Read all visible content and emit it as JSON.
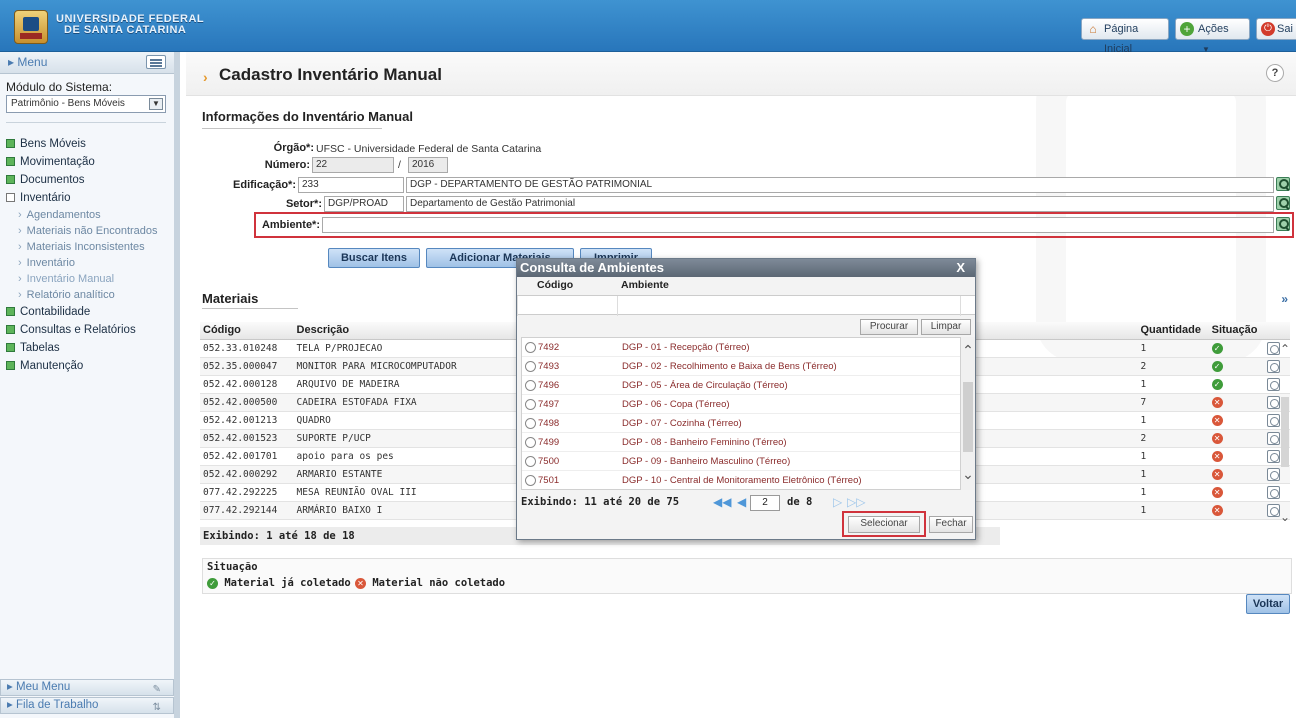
{
  "header": {
    "university_line1": "UNIVERSIDADE FEDERAL",
    "university_line2": "DE SANTA CATARINA",
    "home_label": "Página Inicial",
    "actions_label": "Ações",
    "exit_label": "Sai"
  },
  "sidebar": {
    "menu_label": "Menu",
    "module_label": "Módulo do Sistema:",
    "module_value": "Patrimônio - Bens Móveis",
    "items": [
      {
        "label": "Bens Móveis"
      },
      {
        "label": "Movimentação"
      },
      {
        "label": "Documentos"
      },
      {
        "label": "Inventário"
      },
      {
        "label": "Agendamentos"
      },
      {
        "label": "Materiais não Encontrados"
      },
      {
        "label": "Materiais Inconsistentes"
      },
      {
        "label": "Inventário"
      },
      {
        "label": "Inventário Manual"
      },
      {
        "label": "Relatório analítico"
      },
      {
        "label": "Contabilidade"
      },
      {
        "label": "Consultas e Relatórios"
      },
      {
        "label": "Tabelas"
      },
      {
        "label": "Manutenção"
      }
    ],
    "footer_my_menu": "Meu Menu",
    "footer_work_queue": "Fila de Trabalho"
  },
  "page": {
    "title": "Cadastro Inventário Manual",
    "section_info": "Informações do Inventário Manual",
    "orgao_label": "Órgão*:",
    "orgao_value": "UFSC - Universidade Federal de Santa Catarina",
    "numero_label": "Número:",
    "numero_value": "22",
    "numero_sep": "/",
    "ano_value": "2016",
    "edificacao_label": "Edificação*:",
    "edificacao_code": "233",
    "edificacao_name": "DGP - DEPARTAMENTO DE GESTÃO PATRIMONIAL",
    "setor_label": "Setor*:",
    "setor_code": "DGP/PROAD",
    "setor_name": "Departamento de Gestão Patrimonial",
    "ambiente_label": "Ambiente*:",
    "ambiente_value": "",
    "btn_buscar": "Buscar Itens",
    "btn_adicionar": "Adicionar Materiais",
    "btn_imprimir": "Imprimir",
    "section_materiais": "Materiais",
    "btn_voltar": "Voltar"
  },
  "table": {
    "headers": {
      "codigo": "Código",
      "descricao": "Descrição",
      "quantidade": "Quantidade",
      "situacao": "Situação"
    },
    "rows": [
      {
        "codigo": "052.33.010248",
        "descricao": "TELA P/PROJECAO",
        "quantidade": "1",
        "status": "ok"
      },
      {
        "codigo": "052.35.000047",
        "descricao": "MONITOR PARA MICROCOMPUTADOR",
        "quantidade": "2",
        "status": "ok"
      },
      {
        "codigo": "052.42.000128",
        "descricao": "ARQUIVO DE MADEIRA",
        "quantidade": "1",
        "status": "ok"
      },
      {
        "codigo": "052.42.000500",
        "descricao": "CADEIRA ESTOFADA FIXA",
        "quantidade": "7",
        "status": "no"
      },
      {
        "codigo": "052.42.001213",
        "descricao": "QUADRO",
        "quantidade": "1",
        "status": "no"
      },
      {
        "codigo": "052.42.001523",
        "descricao": "SUPORTE P/UCP",
        "quantidade": "2",
        "status": "no"
      },
      {
        "codigo": "052.42.001701",
        "descricao": "apoio para os pes",
        "quantidade": "1",
        "status": "no"
      },
      {
        "codigo": "052.42.000292",
        "descricao": "ARMARIO ESTANTE",
        "quantidade": "1",
        "status": "no"
      },
      {
        "codigo": "077.42.292225",
        "descricao": "MESA REUNIÃO OVAL III",
        "quantidade": "1",
        "status": "no"
      },
      {
        "codigo": "077.42.292144",
        "descricao": "ARMÁRIO BAIXO I",
        "quantidade": "1",
        "status": "no"
      }
    ],
    "footer": "Exibindo: 1 até 18 de 18"
  },
  "legend": {
    "title": "Situação",
    "collected": "Material já coletado",
    "not_collected": "Material não coletado"
  },
  "modal": {
    "title": "Consulta de Ambientes",
    "close": "X",
    "col_codigo": "Código",
    "col_ambiente": "Ambiente",
    "btn_procurar": "Procurar",
    "btn_limpar": "Limpar",
    "rows": [
      {
        "codigo": "7492",
        "ambiente": "DGP - 01 - Recepção (Térreo)"
      },
      {
        "codigo": "7493",
        "ambiente": "DGP - 02 - Recolhimento e Baixa de Bens (Térreo)"
      },
      {
        "codigo": "7496",
        "ambiente": "DGP - 05 - Área de Circulação (Térreo)"
      },
      {
        "codigo": "7497",
        "ambiente": "DGP - 06 - Copa (Térreo)"
      },
      {
        "codigo": "7498",
        "ambiente": "DGP - 07 - Cozinha (Térreo)"
      },
      {
        "codigo": "7499",
        "ambiente": "DGP - 08 - Banheiro Feminino (Térreo)"
      },
      {
        "codigo": "7500",
        "ambiente": "DGP - 09 - Banheiro Masculino (Térreo)"
      },
      {
        "codigo": "7501",
        "ambiente": "DGP - 10 - Central de Monitoramento Eletrônico (Térreo)"
      }
    ],
    "footer": "Exibindo: 11 até 20 de 75",
    "page_current": "2",
    "page_of": "de 8",
    "btn_selecionar": "Selecionar",
    "btn_fechar": "Fechar"
  },
  "colors": {
    "header_blue": "#2f84c8",
    "highlight_red": "#d0333c",
    "ok_green": "#3f9c3a",
    "not_collected_red": "#d9573a"
  }
}
